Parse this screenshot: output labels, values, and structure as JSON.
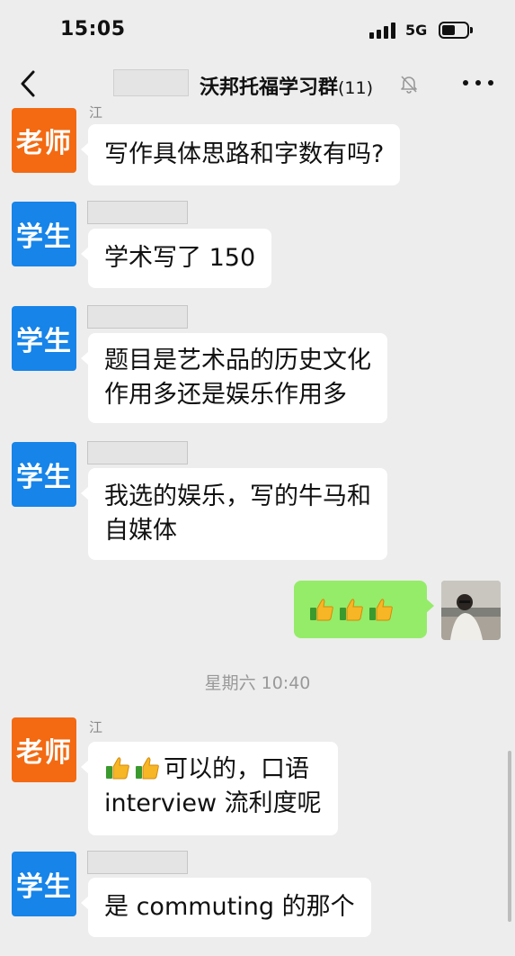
{
  "status_bar": {
    "time": "15:05",
    "network": "5G"
  },
  "nav": {
    "title": "沃邦托福学习群",
    "member_count": "(11)"
  },
  "roles": {
    "teacher": "老师",
    "student": "学生"
  },
  "messages": [
    {
      "role": "teacher",
      "sender": "江",
      "lines": [
        "写作具体思路和字数有吗?"
      ]
    },
    {
      "role": "student",
      "sender": "",
      "lines": [
        "学术写了 150"
      ]
    },
    {
      "role": "student",
      "sender": "",
      "lines": [
        "题目是艺术品的历史文化",
        "作用多还是娱乐作用多"
      ]
    },
    {
      "role": "student",
      "sender": "",
      "lines": [
        "我选的娱乐，写的牛马和",
        "自媒体"
      ]
    },
    {
      "role": "me",
      "emoji": [
        "thumbs-up",
        "thumbs-up",
        "thumbs-up"
      ]
    },
    {
      "role": "teacher",
      "sender": "江",
      "lines": [
        "可以的，口语",
        "interview 流利度呢"
      ],
      "leading_emoji": [
        "thumbs-up",
        "thumbs-up"
      ]
    },
    {
      "role": "student",
      "sender": "",
      "lines": [
        "是 commuting 的那个"
      ]
    }
  ],
  "timestamp": "星期六 10:40",
  "colors": {
    "teacher_avatar": "#f36a12",
    "student_avatar": "#1684e9",
    "my_bubble": "#95ec69",
    "background": "#ededed"
  }
}
